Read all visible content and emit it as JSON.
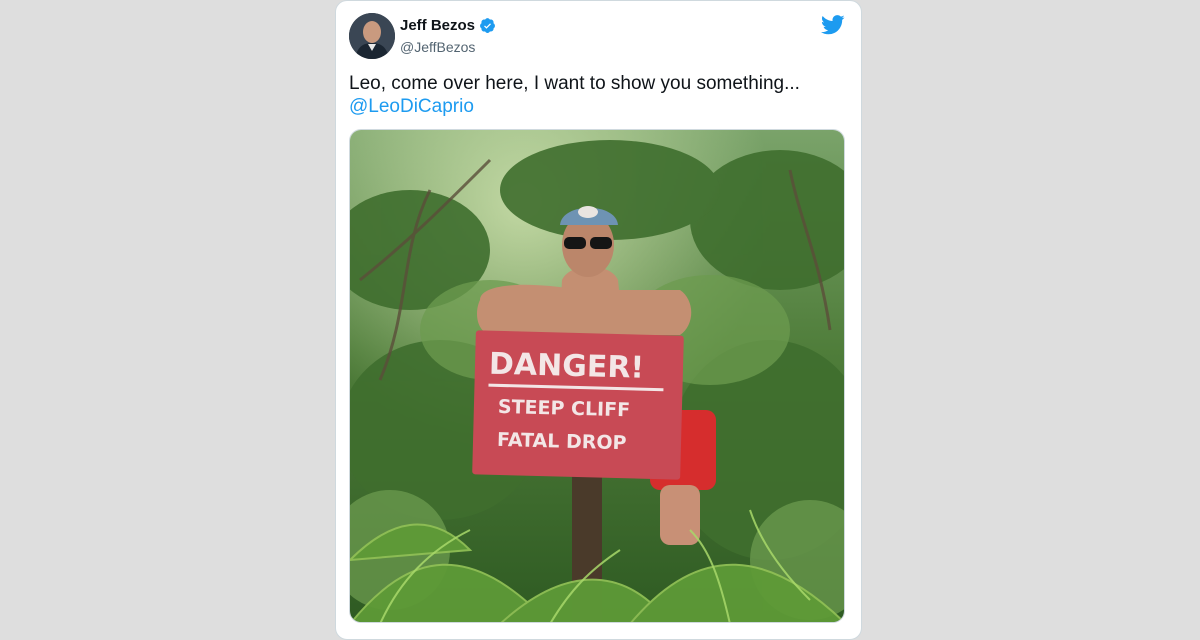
{
  "tweet": {
    "author": {
      "display_name": "Jeff Bezos",
      "handle": "@JeffBezos",
      "verified": true
    },
    "text": "Leo, come over here, I want to show you something...",
    "mention": "@LeoDiCaprio",
    "photo": {
      "sign_line_1": "DANGER!",
      "sign_line_2": "STEEP CLIFF",
      "sign_line_3": "FATAL DROP"
    }
  },
  "colors": {
    "page_background": "#dedede",
    "card_background": "#ffffff",
    "twitter_blue": "#1d9bf0",
    "text_primary": "#0f1419",
    "text_secondary": "#536471",
    "sign_red": "#c84a55"
  },
  "icons": {
    "verified": "verified-badge-icon",
    "brand": "twitter-bird-icon"
  }
}
